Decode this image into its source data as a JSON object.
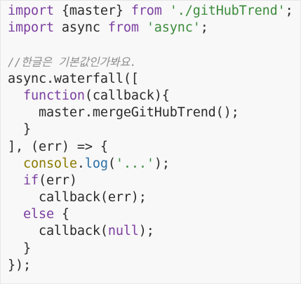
{
  "code": {
    "lines": [
      [
        {
          "t": "import",
          "c": "kw"
        },
        {
          "t": " {master} ",
          "c": "plain"
        },
        {
          "t": "from",
          "c": "kw"
        },
        {
          "t": " ",
          "c": "plain"
        },
        {
          "t": "'./gitHubTrend'",
          "c": "str"
        },
        {
          "t": ";",
          "c": "plain"
        }
      ],
      [
        {
          "t": "import",
          "c": "kw"
        },
        {
          "t": " async ",
          "c": "plain"
        },
        {
          "t": "from",
          "c": "kw"
        },
        {
          "t": " ",
          "c": "plain"
        },
        {
          "t": "'async'",
          "c": "str"
        },
        {
          "t": ";",
          "c": "plain"
        }
      ],
      [],
      [
        {
          "t": "//한글은 기본값인가봐요.",
          "c": "com"
        }
      ],
      [
        {
          "t": "async.waterfall([",
          "c": "plain"
        }
      ],
      [
        {
          "t": "  ",
          "c": "plain"
        },
        {
          "t": "function",
          "c": "kw"
        },
        {
          "t": "(callback){",
          "c": "plain"
        }
      ],
      [
        {
          "t": "    master.mergeGitHubTrend();",
          "c": "plain"
        }
      ],
      [
        {
          "t": "  }",
          "c": "plain"
        }
      ],
      [
        {
          "t": "], (err) => {",
          "c": "plain"
        }
      ],
      [
        {
          "t": "  ",
          "c": "plain"
        },
        {
          "t": "console",
          "c": "fn"
        },
        {
          "t": ".",
          "c": "plain"
        },
        {
          "t": "log",
          "c": "blt"
        },
        {
          "t": "(",
          "c": "plain"
        },
        {
          "t": "'...'",
          "c": "str"
        },
        {
          "t": ");",
          "c": "plain"
        }
      ],
      [
        {
          "t": "  ",
          "c": "plain"
        },
        {
          "t": "if",
          "c": "kw"
        },
        {
          "t": "(err)",
          "c": "plain"
        }
      ],
      [
        {
          "t": "    callback(err);",
          "c": "plain"
        }
      ],
      [
        {
          "t": "  ",
          "c": "plain"
        },
        {
          "t": "else",
          "c": "kw"
        },
        {
          "t": " {",
          "c": "plain"
        }
      ],
      [
        {
          "t": "    callback(",
          "c": "plain"
        },
        {
          "t": "null",
          "c": "kw"
        },
        {
          "t": ");",
          "c": "plain"
        }
      ],
      [
        {
          "t": "  }",
          "c": "plain"
        }
      ],
      [
        {
          "t": "});",
          "c": "plain"
        }
      ]
    ]
  },
  "colors": {
    "background": "#f8f8f8",
    "keyword": "#7b3fa0",
    "string": "#3b8b3b",
    "comment": "#8e8e8e",
    "console": "#8a7a00",
    "method": "#2a6fa8",
    "text": "#2b2b2b"
  }
}
